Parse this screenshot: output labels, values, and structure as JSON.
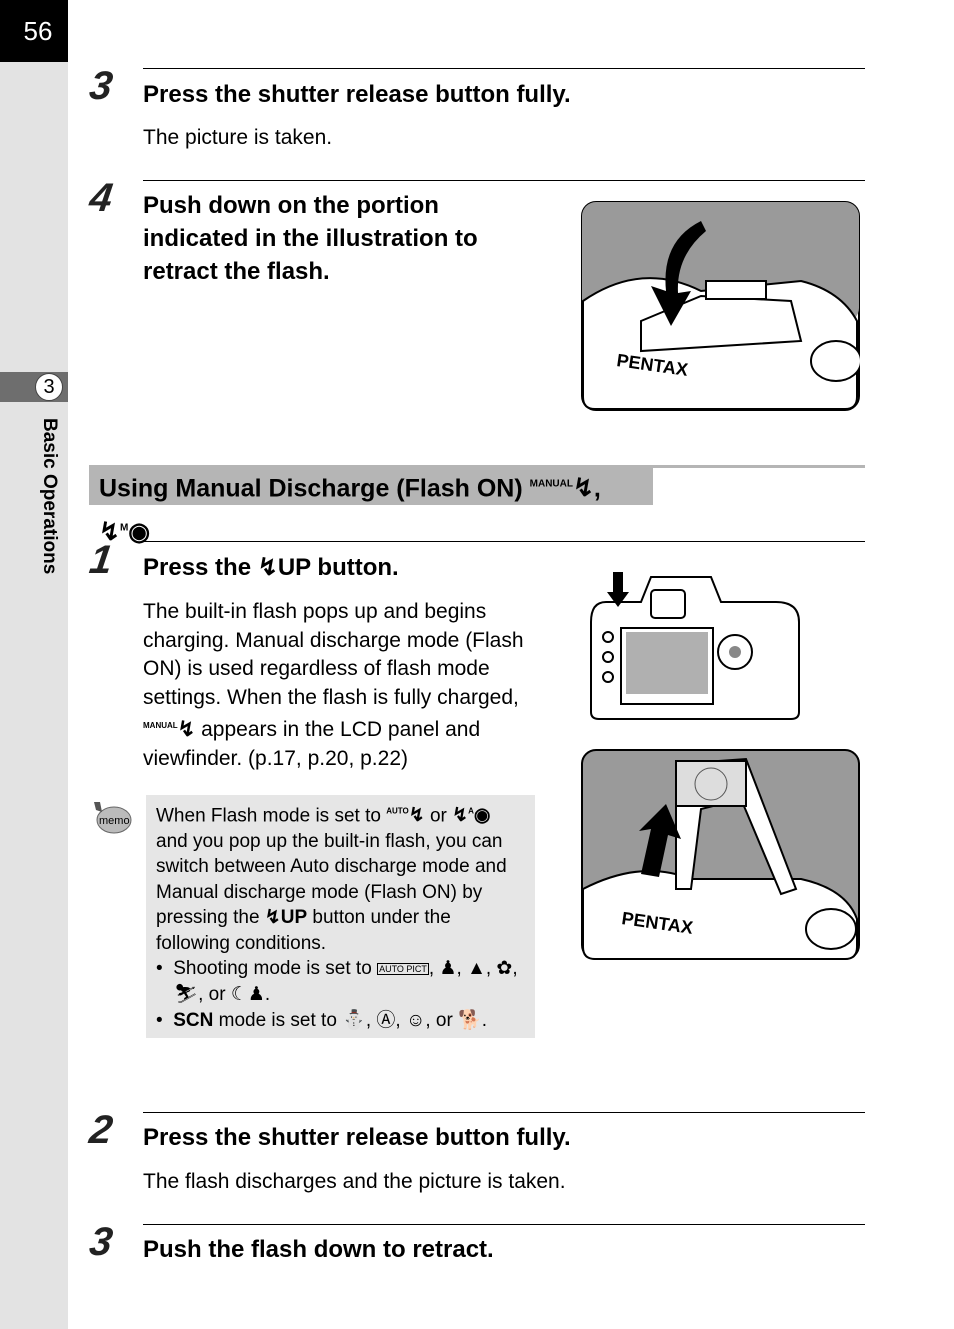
{
  "page_number": "56",
  "chapter": {
    "number": "3",
    "title": "Basic Operations"
  },
  "top_steps": [
    {
      "number": "3",
      "heading": "Press the shutter release button fully.",
      "body": "The picture is taken."
    },
    {
      "number": "4",
      "heading": "Push down on the portion indicated in the illustration to retract the flash."
    }
  ],
  "section": {
    "title": "Using Manual Discharge (Flash ON)",
    "icon1_label": "MANUAL",
    "separator": ",",
    "icon2_label": "M"
  },
  "step1": {
    "number": "1",
    "heading_pre": "Press the",
    "heading_icon": "UP",
    "heading_post": "button.",
    "body_pre": "The built-in flash pops up and begins charging. Manual discharge mode (Flash ON) is used regardless of flash mode settings. When the flash is fully charged,",
    "body_icon": "MANUAL",
    "body_post": "appears in the LCD panel and viewfinder. (p.17, p.20, p.22)"
  },
  "memo": {
    "icon_label": "memo",
    "p1_a": "When Flash mode is set to",
    "p1_icon1": "AUTO",
    "p1_b": "or",
    "p1_icon2": "A",
    "p1_c": "and you pop up the built-in flash, you can switch between Auto discharge mode and Manual discharge mode (Flash ON) by pressing the",
    "p1_icon3": "UP",
    "p1_d": "button under the following conditions.",
    "bullet1_pre": "Shooting mode is set to",
    "bullet1_icon": "AUTO PICT",
    "bullet1_post": ", ♟, ▲, ✿, ⛷, or ☾♟.",
    "bullet2_icon": "SCN",
    "bullet2_post": "mode is set to ⛄, Ⓐ, ☺, or 🐕."
  },
  "bottom_steps": [
    {
      "number": "2",
      "heading": "Press the shutter release button fully.",
      "body": "The flash discharges and the picture is taken."
    },
    {
      "number": "3",
      "heading": "Push the flash down to retract."
    }
  ],
  "illustrations": {
    "brand_label": "PENTAX"
  }
}
